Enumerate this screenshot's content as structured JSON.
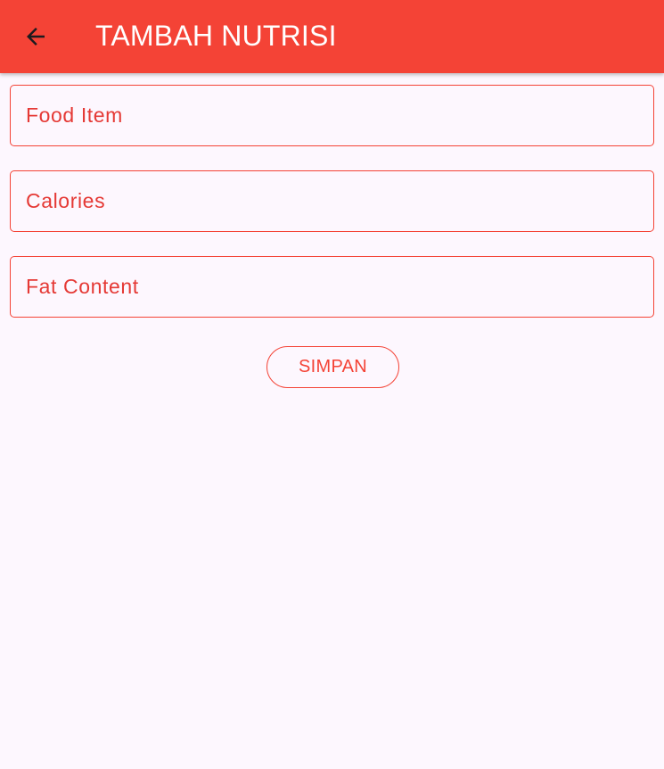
{
  "appbar": {
    "title": "TAMBAH NUTRISI",
    "back_icon": "arrow-back-icon",
    "color": "#f44336"
  },
  "form": {
    "food_item": {
      "value": "",
      "placeholder": "Food Item"
    },
    "calories": {
      "value": "",
      "placeholder": "Calories"
    },
    "fat_content": {
      "value": "",
      "placeholder": "Fat Content"
    }
  },
  "actions": {
    "save_label": "SIMPAN"
  },
  "colors": {
    "accent": "#f44336",
    "background": "#fdf7fe"
  }
}
